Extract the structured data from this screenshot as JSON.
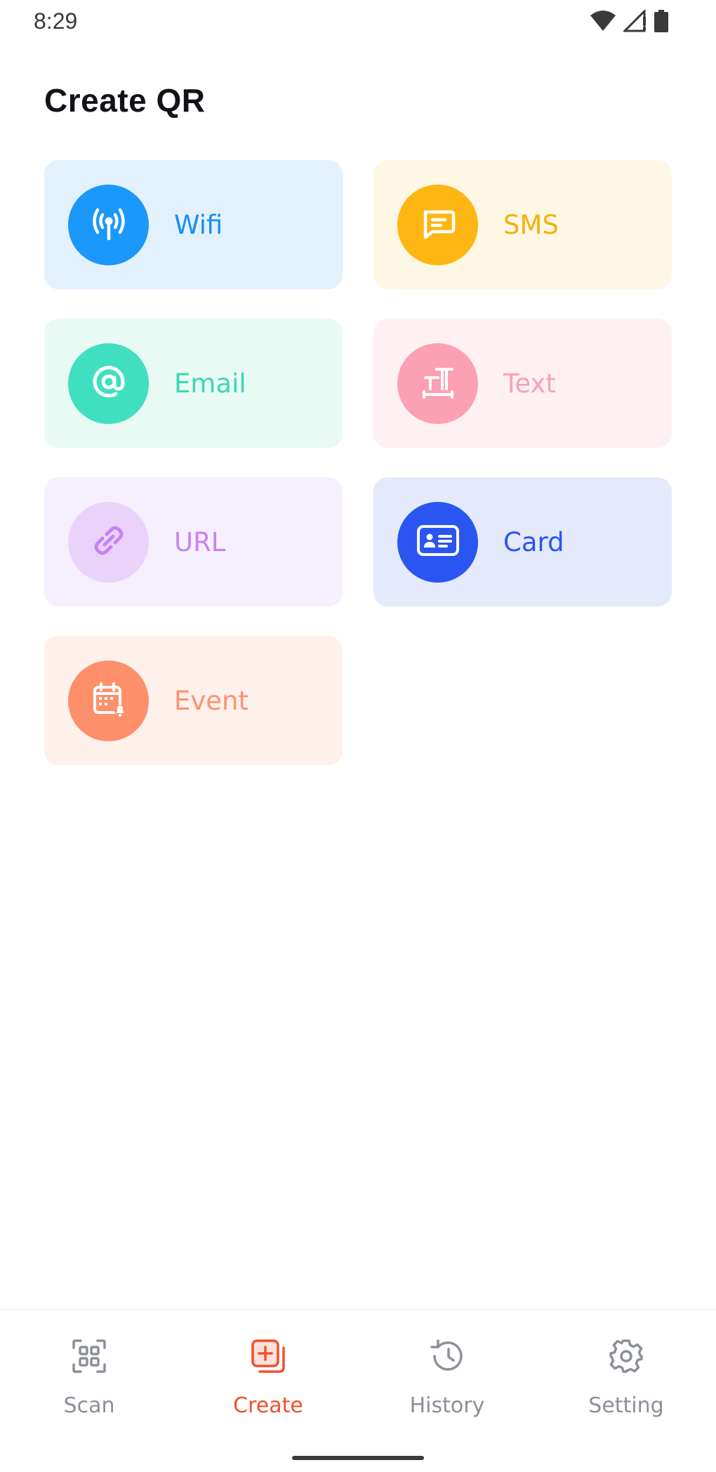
{
  "status_bar": {
    "time": "8:29",
    "icons": [
      "wifi-icon",
      "cellular-signal-icon",
      "battery-icon"
    ]
  },
  "page": {
    "title": "Create QR"
  },
  "tiles": [
    {
      "label": "Wifi",
      "icon": "wifi-antenna-icon",
      "bg": "#e3f1fd",
      "circle": "#1a98fb",
      "text_color": "#1a8ef5"
    },
    {
      "label": "SMS",
      "icon": "message-icon",
      "bg": "#fef7e3",
      "circle": "#fdb613",
      "text_color": "#f6b00e"
    },
    {
      "label": "Email",
      "icon": "at-icon",
      "bg": "#e9faf5",
      "circle": "#3fdfbf",
      "text_color": "#3dd6b5"
    },
    {
      "label": "Text",
      "icon": "text-format-icon",
      "bg": "#fff1f3",
      "circle": "#fca0b3",
      "text_color": "#f7a2b3"
    },
    {
      "label": "URL",
      "icon": "link-icon",
      "bg": "#f6effd",
      "circle": "#ead3fb",
      "text_color": "#c684f2"
    },
    {
      "label": "Card",
      "icon": "id-card-icon",
      "bg": "#e4eafc",
      "circle": "#2a55f0",
      "text_color": "#2a55ef"
    },
    {
      "label": "Event",
      "icon": "calendar-icon",
      "bg": "#fef0ea",
      "circle": "#fd8f6b",
      "text_color": "#f99474"
    }
  ],
  "nav": {
    "items": [
      {
        "label": "Scan",
        "icon": "scan-icon"
      },
      {
        "label": "Create",
        "icon": "create-icon"
      },
      {
        "label": "History",
        "icon": "history-icon"
      },
      {
        "label": "Setting",
        "icon": "gear-icon"
      }
    ],
    "active": "Create",
    "active_color": "#f0502e",
    "inactive_color": "#8b8f98"
  }
}
